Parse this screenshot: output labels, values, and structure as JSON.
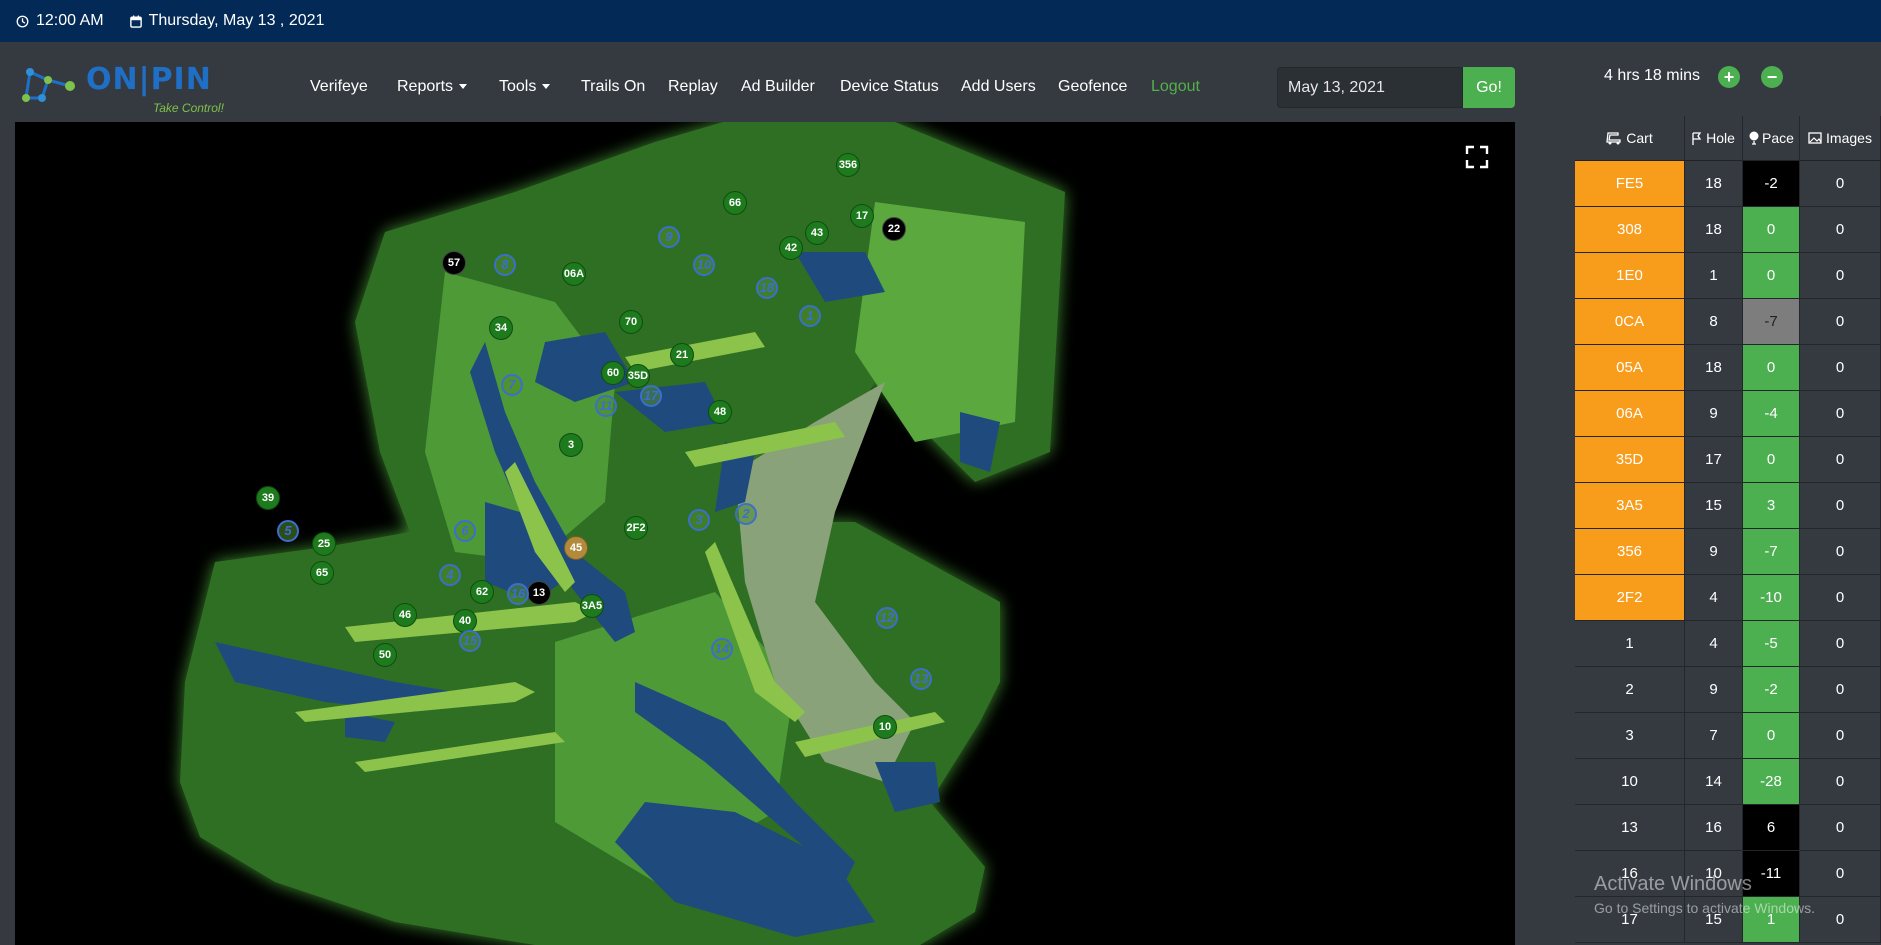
{
  "topbar": {
    "time": "12:00 AM",
    "date": "Thursday, May 13 , 2021"
  },
  "logo": {
    "name": "ON|PIN",
    "tagline": "Take Control!"
  },
  "nav": {
    "verifeye": "Verifeye",
    "reports": "Reports",
    "tools": "Tools",
    "trails": "Trails On",
    "replay": "Replay",
    "ad_builder": "Ad Builder",
    "device_status": "Device Status",
    "add_users": "Add Users",
    "geofence": "Geofence",
    "logout": "Logout"
  },
  "date_picker": {
    "value": "May 13, 2021",
    "go_label": "Go!"
  },
  "timer": {
    "label": "4 hrs 18 mins",
    "plus": "+",
    "minus": "−"
  },
  "colors": {
    "topbar": "#032a57",
    "accent_green": "#4caf50",
    "orange": "#f89c1c",
    "navbar": "#343a40"
  },
  "map": {
    "markers": [
      "356",
      "66",
      "17",
      "22",
      "43",
      "42",
      "57",
      "06A",
      "70",
      "21",
      "60",
      "35D",
      "48",
      "34",
      "3",
      "39",
      "2F2",
      "25",
      "65",
      "45",
      "46",
      "62",
      "13",
      "3A5",
      "40",
      "50",
      "10"
    ],
    "hole_labels": [
      "9",
      "8",
      "10",
      "18",
      "1",
      "7",
      "11",
      "17",
      "6",
      "5",
      "4",
      "3",
      "2",
      "16",
      "15",
      "14",
      "12",
      "13"
    ]
  },
  "table": {
    "headers": {
      "cart": "Cart",
      "hole": "Hole",
      "pace": "Pace",
      "images": "Images"
    },
    "rows": [
      {
        "cart": "FE5",
        "hole": "18",
        "pace": "-2",
        "images": "0"
      },
      {
        "cart": "308",
        "hole": "18",
        "pace": "0",
        "images": "0"
      },
      {
        "cart": "1E0",
        "hole": "1",
        "pace": "0",
        "images": "0"
      },
      {
        "cart": "0CA",
        "hole": "8",
        "pace": "-7",
        "images": "0"
      },
      {
        "cart": "05A",
        "hole": "18",
        "pace": "0",
        "images": "0"
      },
      {
        "cart": "06A",
        "hole": "9",
        "pace": "-4",
        "images": "0"
      },
      {
        "cart": "35D",
        "hole": "17",
        "pace": "0",
        "images": "0"
      },
      {
        "cart": "3A5",
        "hole": "15",
        "pace": "3",
        "images": "0"
      },
      {
        "cart": "356",
        "hole": "9",
        "pace": "-7",
        "images": "0"
      },
      {
        "cart": "2F2",
        "hole": "4",
        "pace": "-10",
        "images": "0"
      },
      {
        "cart": "1",
        "hole": "4",
        "pace": "-5",
        "images": "0"
      },
      {
        "cart": "2",
        "hole": "9",
        "pace": "-2",
        "images": "0"
      },
      {
        "cart": "3",
        "hole": "7",
        "pace": "0",
        "images": "0"
      },
      {
        "cart": "10",
        "hole": "14",
        "pace": "-28",
        "images": "0"
      },
      {
        "cart": "13",
        "hole": "16",
        "pace": "6",
        "images": "0"
      },
      {
        "cart": "16",
        "hole": "10",
        "pace": "-11",
        "images": "0"
      },
      {
        "cart": "17",
        "hole": "15",
        "pace": "1",
        "images": "0"
      }
    ]
  },
  "watermark": {
    "title": "Activate Windows",
    "subtitle": "Go to Settings to activate Windows."
  }
}
